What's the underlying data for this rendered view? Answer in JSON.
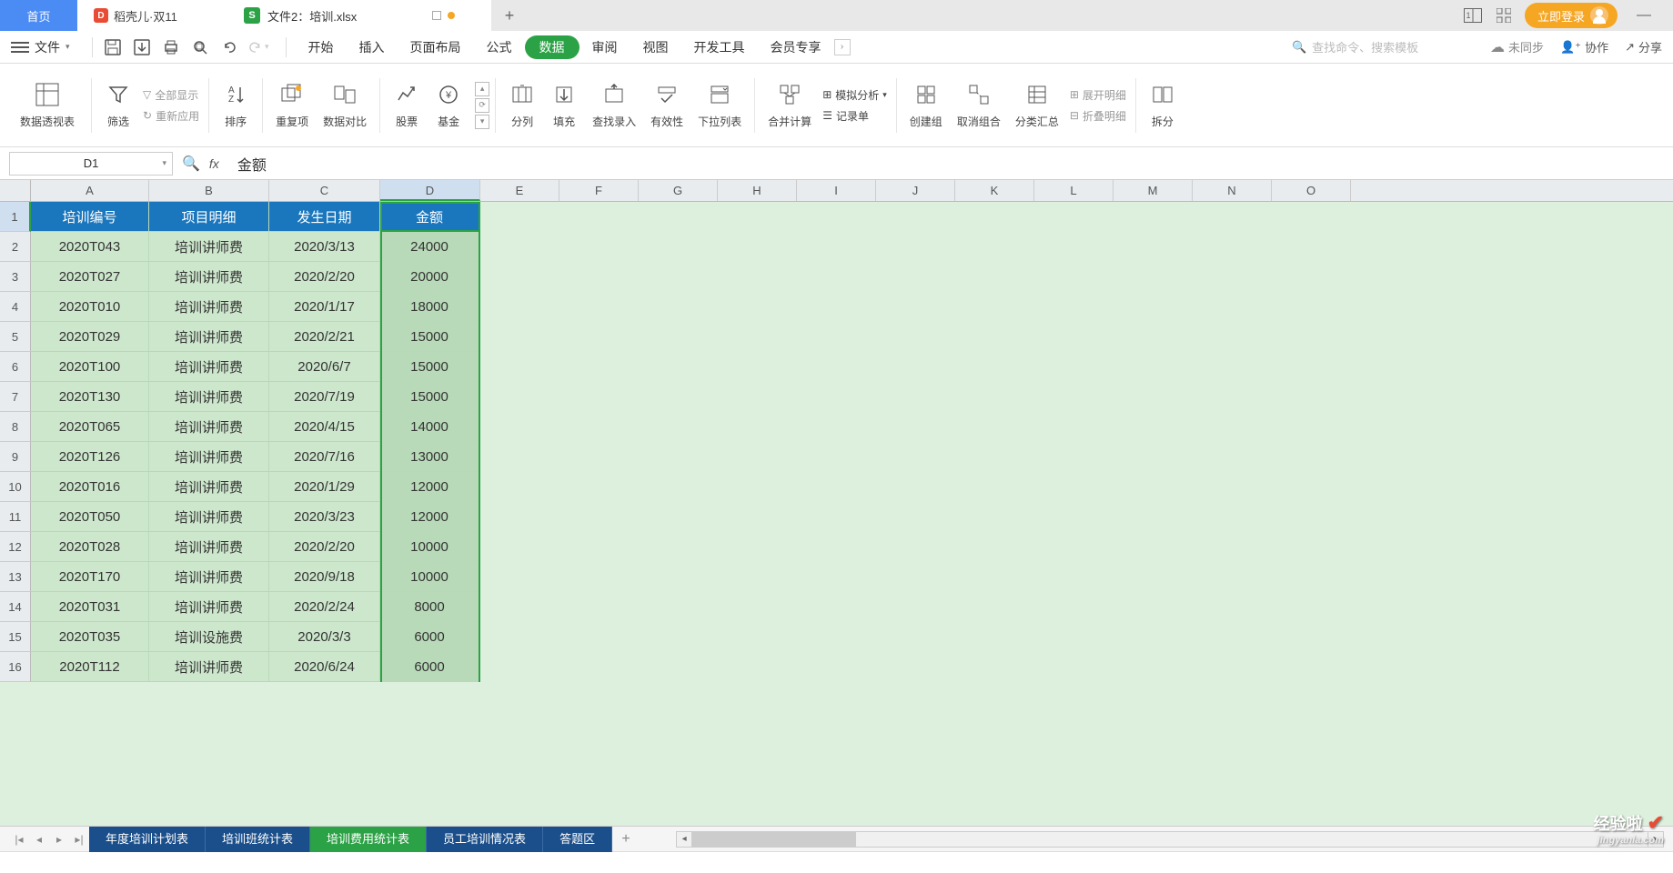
{
  "titlebar": {
    "home": "首页",
    "doke": "稻壳儿·双11",
    "file_prefix": "文件2：",
    "filename": "培训.xlsx",
    "login": "立即登录"
  },
  "menubar": {
    "file": "文件",
    "tabs": [
      "开始",
      "插入",
      "页面布局",
      "公式",
      "数据",
      "审阅",
      "视图",
      "开发工具",
      "会员专享"
    ],
    "search_placeholder": "查找命令、搜索模板",
    "unsync": "未同步",
    "collab": "协作",
    "share": "分享"
  },
  "ribbon": {
    "pivot": "数据透视表",
    "filter": "筛选",
    "showall": "全部显示",
    "reapply": "重新应用",
    "sort": "排序",
    "dup": "重复项",
    "compare": "数据对比",
    "stock": "股票",
    "fund": "基金",
    "split": "分列",
    "fill": "填充",
    "lookup": "查找录入",
    "validation": "有效性",
    "dropdown": "下拉列表",
    "consolidate": "合并计算",
    "whatif": "模拟分析",
    "record": "记录单",
    "group": "创建组",
    "ungroup": "取消组合",
    "subtotal": "分类汇总",
    "expand": "展开明细",
    "collapse": "折叠明细",
    "splitpane": "拆分"
  },
  "formula": {
    "cellref": "D1",
    "value": "金额"
  },
  "sheet": {
    "columns": [
      "A",
      "B",
      "C",
      "D",
      "E",
      "F",
      "G",
      "H",
      "I",
      "J",
      "K",
      "L",
      "M",
      "N",
      "O"
    ],
    "headers": [
      "培训编号",
      "项目明细",
      "发生日期",
      "金额"
    ],
    "rows": [
      [
        "2020T043",
        "培训讲师费",
        "2020/3/13",
        "24000"
      ],
      [
        "2020T027",
        "培训讲师费",
        "2020/2/20",
        "20000"
      ],
      [
        "2020T010",
        "培训讲师费",
        "2020/1/17",
        "18000"
      ],
      [
        "2020T029",
        "培训讲师费",
        "2020/2/21",
        "15000"
      ],
      [
        "2020T100",
        "培训讲师费",
        "2020/6/7",
        "15000"
      ],
      [
        "2020T130",
        "培训讲师费",
        "2020/7/19",
        "15000"
      ],
      [
        "2020T065",
        "培训讲师费",
        "2020/4/15",
        "14000"
      ],
      [
        "2020T126",
        "培训讲师费",
        "2020/7/16",
        "13000"
      ],
      [
        "2020T016",
        "培训讲师费",
        "2020/1/29",
        "12000"
      ],
      [
        "2020T050",
        "培训讲师费",
        "2020/3/23",
        "12000"
      ],
      [
        "2020T028",
        "培训讲师费",
        "2020/2/20",
        "10000"
      ],
      [
        "2020T170",
        "培训讲师费",
        "2020/9/18",
        "10000"
      ],
      [
        "2020T031",
        "培训讲师费",
        "2020/2/24",
        "8000"
      ],
      [
        "2020T035",
        "培训设施费",
        "2020/3/3",
        "6000"
      ],
      [
        "2020T112",
        "培训讲师费",
        "2020/6/24",
        "6000"
      ]
    ]
  },
  "sheettabs": {
    "tabs": [
      "年度培训计划表",
      "培训班统计表",
      "培训费用统计表",
      "员工培训情况表",
      "答题区"
    ],
    "active": 2
  },
  "watermark": {
    "main": "经验啦",
    "sub": "jingyanla.com"
  }
}
